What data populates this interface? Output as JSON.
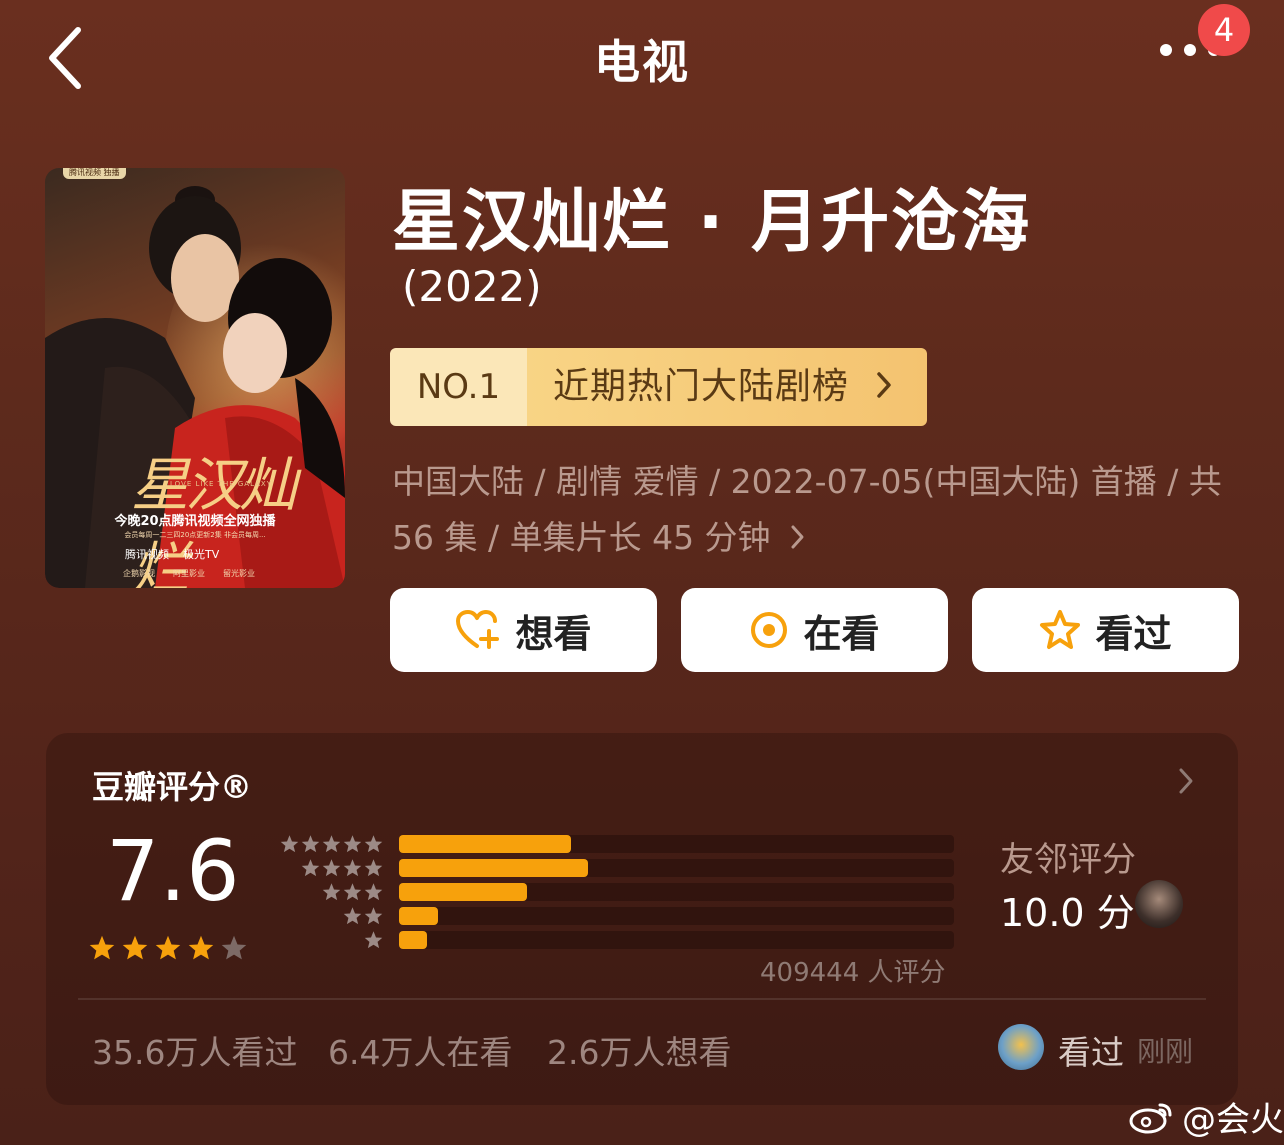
{
  "nav": {
    "title": "电视",
    "back_icon": "chevron-left-icon",
    "more_icon": "more-dots-icon",
    "badge": "4"
  },
  "poster": {
    "top_tag": "腾讯视频 独播",
    "calligraphy": "星汉灿烂",
    "subtitle": "LOVE LIKE THE GALAXY",
    "promo": "今晚20点腾讯视频全网独播",
    "schedule": "会员每周一二三四20点更新2集 非会员每周...",
    "logos": [
      "腾讯视频",
      "极光TV"
    ],
    "studios": [
      "企鹅影视",
      "阿里影业",
      "留光影业"
    ]
  },
  "show": {
    "title": "星汉灿烂 · 月升沧海",
    "year": "(2022)"
  },
  "rank": {
    "no": "NO.1",
    "label": "近期热门大陆剧榜"
  },
  "meta": {
    "line1": "中国大陆 / 剧情 爱情 / 2022-07-05(中国大陆) 首播 / 共",
    "line2": "56 集 / 单集片长 45 分钟"
  },
  "actions": [
    {
      "label": "想看",
      "icon": "heart-plus-icon"
    },
    {
      "label": "在看",
      "icon": "target-icon"
    },
    {
      "label": "看过",
      "icon": "star-outline-icon"
    }
  ],
  "rating": {
    "section_title": "豆瓣评分®",
    "score": "7.6",
    "stars": 4,
    "distribution": [
      {
        "stars": 5,
        "fraction": 0.31
      },
      {
        "stars": 4,
        "fraction": 0.34
      },
      {
        "stars": 3,
        "fraction": 0.23
      },
      {
        "stars": 2,
        "fraction": 0.07
      },
      {
        "stars": 1,
        "fraction": 0.05
      }
    ],
    "count_text": "409444 人评分",
    "friend_label": "友邻评分",
    "friend_score": "10.0 分"
  },
  "stats": {
    "seen": "35.6万人看过",
    "watching": "6.4万人在看",
    "want": "2.6万人想看"
  },
  "activity": {
    "action": "看过",
    "time": "刚刚"
  },
  "watermark": "@会火",
  "colors": {
    "accent": "#f7a10c",
    "rank_bg": "#f4c370",
    "badge": "#f04a4a"
  }
}
